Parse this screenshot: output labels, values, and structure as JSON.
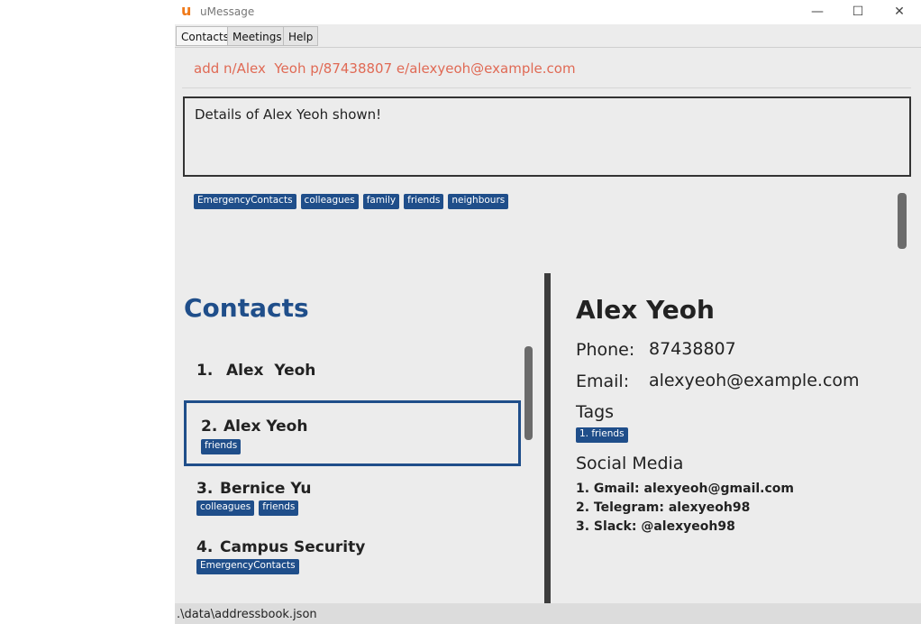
{
  "window": {
    "title": "uMessage",
    "icon": "u-logo-icon",
    "controls": [
      "—",
      "☐",
      "✕"
    ]
  },
  "menu": {
    "items": [
      {
        "label": "Contacts"
      },
      {
        "label": "Meetings"
      },
      {
        "label": "Help"
      }
    ]
  },
  "command": {
    "value": "add n/Alex  Yeoh p/87438807 e/alexyeoh@example.com"
  },
  "result": {
    "text": "Details of Alex Yeoh shown!"
  },
  "tags_bar": [
    "EmergencyContacts",
    "colleagues",
    "family",
    "friends",
    "neighbours"
  ],
  "contacts": {
    "title": "Contacts",
    "list": [
      {
        "index": "1.",
        "name": "Alex  Yeoh",
        "tags": []
      },
      {
        "index": "2.",
        "name": "Alex Yeoh",
        "tags": [
          "friends"
        ]
      },
      {
        "index": "3.",
        "name": "Bernice Yu",
        "tags": [
          "colleagues",
          "friends"
        ]
      },
      {
        "index": "4.",
        "name": "Campus Security",
        "tags": [
          "EmergencyContacts"
        ]
      }
    ]
  },
  "detail": {
    "name": "Alex Yeoh",
    "phone_label": "Phone:",
    "phone": "87438807",
    "email_label": "Email:",
    "email": "alexyeoh@example.com",
    "tags_label": "Tags",
    "tags": [
      "1. friends"
    ],
    "social_label": "Social Media",
    "social": [
      "1. Gmail: alexyeoh@gmail.com",
      "2. Telegram: alexyeoh98",
      "3. Slack: @alexyeoh98"
    ]
  },
  "status": {
    "path": ".\\data\\addressbook.json"
  },
  "colors": {
    "accent": "#1f4e8a",
    "command_text": "#e06a55",
    "panel_bg": "#ececec"
  }
}
